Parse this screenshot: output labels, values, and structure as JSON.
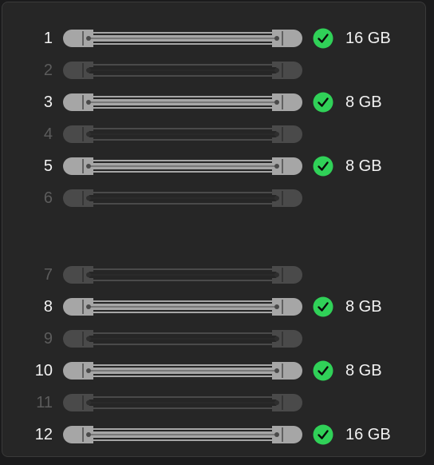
{
  "colors": {
    "installed_text": "#f2f2f2",
    "empty_text": "#5c5c5c",
    "check_green": "#30d158",
    "installed_body": "#a6a6a6",
    "empty_body": "#4a4a4a"
  },
  "icons": {
    "check": "checkmark-circle-icon",
    "slot": "dimm-slot-icon"
  },
  "slots": [
    {
      "number": "1",
      "installed": true,
      "size": "16 GB"
    },
    {
      "number": "2",
      "installed": false,
      "size": ""
    },
    {
      "number": "3",
      "installed": true,
      "size": "8 GB"
    },
    {
      "number": "4",
      "installed": false,
      "size": ""
    },
    {
      "number": "5",
      "installed": true,
      "size": "8 GB"
    },
    {
      "number": "6",
      "installed": false,
      "size": ""
    },
    {
      "number": "7",
      "installed": false,
      "size": ""
    },
    {
      "number": "8",
      "installed": true,
      "size": "8 GB"
    },
    {
      "number": "9",
      "installed": false,
      "size": ""
    },
    {
      "number": "10",
      "installed": true,
      "size": "8 GB"
    },
    {
      "number": "11",
      "installed": false,
      "size": ""
    },
    {
      "number": "12",
      "installed": true,
      "size": "16 GB"
    }
  ]
}
